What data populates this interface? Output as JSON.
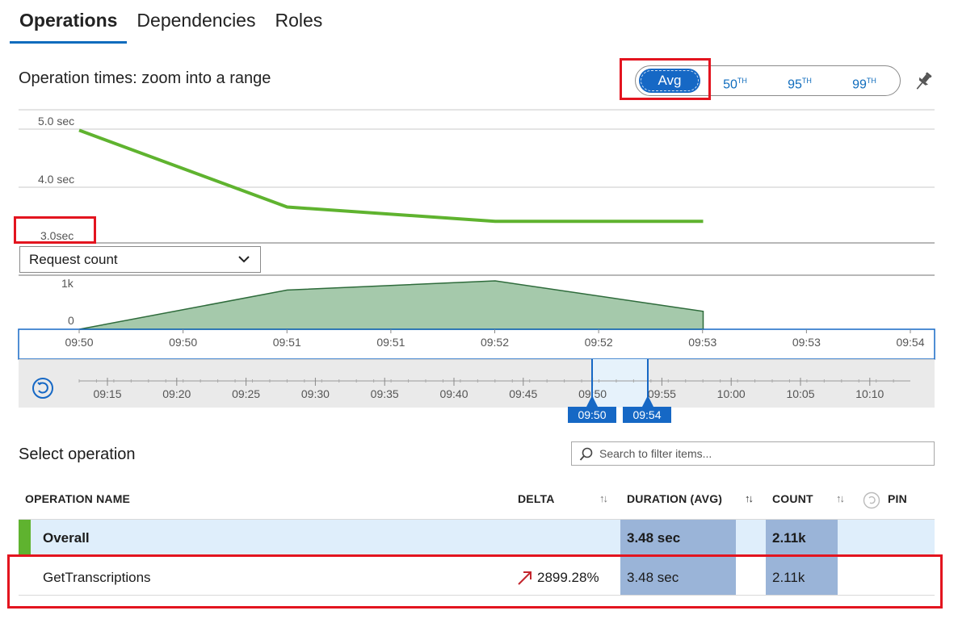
{
  "tabs": [
    {
      "label": "Operations",
      "active": true
    },
    {
      "label": "Dependencies",
      "active": false
    },
    {
      "label": "Roles",
      "active": false
    }
  ],
  "chart_title": "Operation times: zoom into a range",
  "aggregation": {
    "options": [
      {
        "label": "Avg",
        "sup": ""
      },
      {
        "label": "50",
        "sup": "TH"
      },
      {
        "label": "95",
        "sup": "TH"
      },
      {
        "label": "99",
        "sup": "TH"
      }
    ],
    "selected": "Avg"
  },
  "icons": {
    "pin": "pin-icon",
    "dropdown": "chevron-down-icon",
    "reset": "reset-zoom-icon",
    "search": "search-icon",
    "trend": "trend-up-arrow-icon"
  },
  "colors": {
    "accent": "#1668c5",
    "duration_line": "#5fb32f",
    "request_area_fill": "#a5c9ab",
    "request_area_stroke": "#2e6b3b",
    "highlight": "#e3141f",
    "column_highlight": "#9ab4d8",
    "overall_row": "#dfeefb"
  },
  "metric_dropdown": {
    "selected": "Request count"
  },
  "chart_data": [
    {
      "type": "line",
      "title": "",
      "y_ticks": [
        "5.0 sec",
        "4.0 sec",
        "3.0sec"
      ],
      "ylim": [
        3.0,
        5.0
      ],
      "x": [
        "09:50",
        "09:51",
        "09:52",
        "09:53"
      ],
      "series": [
        {
          "values": [
            4.84,
            3.5,
            3.25,
            3.25
          ]
        }
      ]
    },
    {
      "type": "area",
      "title": "",
      "y_ticks": [
        "1k",
        "0"
      ],
      "ylim": [
        0,
        1000
      ],
      "x": [
        "09:50",
        "09:51",
        "09:52",
        "09:53"
      ],
      "series": [
        {
          "values": [
            0,
            810,
            1000,
            370
          ]
        }
      ]
    }
  ],
  "x_tick_labels": [
    "09:50",
    "09:50",
    "09:51",
    "09:51",
    "09:52",
    "09:52",
    "09:53",
    "09:53",
    "09:54"
  ],
  "brush": {
    "ticks": [
      "09:15",
      "09:20",
      "09:25",
      "09:30",
      "09:35",
      "09:40",
      "09:45",
      "09:50",
      "09:55",
      "10:00",
      "10:05",
      "10:10"
    ],
    "range_start": "09:50",
    "range_end": "09:54"
  },
  "select_operation": {
    "title": "Select operation",
    "search_placeholder": "Search to filter items..."
  },
  "table": {
    "headers": {
      "operation_name": "OPERATION NAME",
      "delta": "DELTA",
      "duration": "DURATION (AVG)",
      "count": "COUNT",
      "pin": "PIN"
    },
    "sort_glyph": "↑↓",
    "rows": [
      {
        "name": "Overall",
        "delta": "",
        "duration": "3.48 sec",
        "count": "2.11k"
      },
      {
        "name": "GetTranscriptions",
        "delta": "2899.28%",
        "duration": "3.48 sec",
        "count": "2.11k"
      }
    ]
  }
}
